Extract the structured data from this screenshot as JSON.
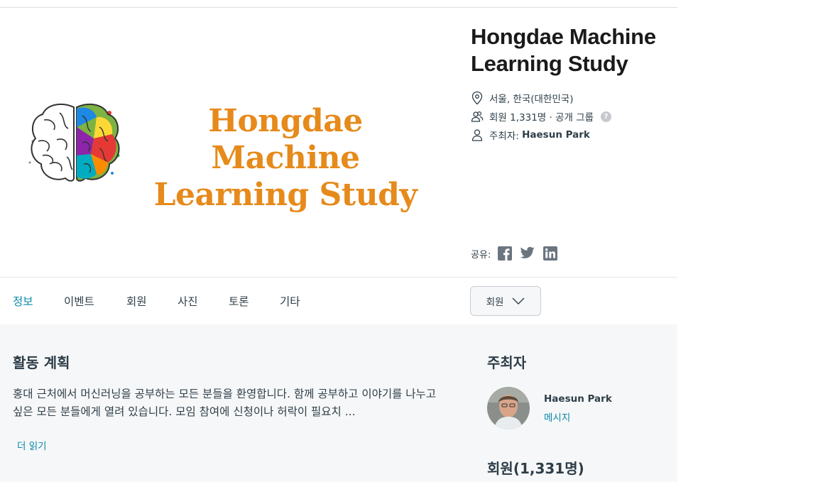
{
  "group": {
    "banner_title_line1": "Hongdae Machine",
    "banner_title_line2": "Learning Study",
    "name": "Hongdae Machine Learning Study",
    "location": "서울, 한국(대한민국)",
    "members_text": "회원 1,331명 · 공개 그룹",
    "help_icon": "?",
    "organizer_prefix": "주최자: ",
    "organizer_name": "Haesun Park",
    "share_label": "공유:"
  },
  "nav": {
    "tabs": [
      "정보",
      "이벤트",
      "회원",
      "사진",
      "토론",
      "기타"
    ],
    "active_tab": "정보",
    "member_button": "회원"
  },
  "about": {
    "heading": "활동 계획",
    "description": "홍대 근처에서 머신러닝을 공부하는 모든 분들을 환영합니다. 함께 공부하고 이야기를 나누고 싶은 모든 분들에게 열려 있습니다. 모임 참여에 신청이나 허락이 필요치 ...",
    "read_more": "더 읽기"
  },
  "organizer_section": {
    "heading": "주최자",
    "name": "Haesun Park",
    "message_link": "메시지"
  },
  "members_section": {
    "prefix": "회원",
    "count": "(1,331명)"
  },
  "colors": {
    "accent": "#0a8aa8",
    "banner_title": "#e68a1b",
    "content_bg": "#f6f7f8",
    "text": "#2e3e48"
  },
  "icons": [
    "location-pin-icon",
    "members-icon",
    "organizer-person-icon",
    "help-icon",
    "facebook-icon",
    "twitter-icon",
    "linkedin-icon",
    "chevron-down-icon",
    "brain-logo"
  ]
}
